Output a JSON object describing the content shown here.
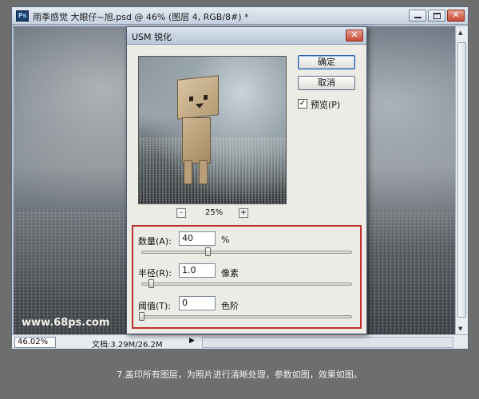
{
  "document": {
    "title": "雨季感觉  大眼仔~旭.psd @ 46% (图层 4, RGB/8#) *",
    "app_icon": "Ps",
    "zoom": "46.02%",
    "doc_size": "文档:3.29M/26.2M",
    "watermark": "www.68ps.com"
  },
  "dialog": {
    "title": "USM 锐化",
    "ok_label": "确定",
    "cancel_label": "取消",
    "preview_label": "预览(P)",
    "preview_checked": true,
    "preview_zoom": "25%",
    "zoom_out": "-",
    "zoom_in": "+",
    "amount": {
      "label": "数量(A):",
      "value": "40",
      "unit": "%"
    },
    "radius": {
      "label": "半径(R):",
      "value": "1.0",
      "unit": "像素"
    },
    "threshold": {
      "label": "阈值(T):",
      "value": "0",
      "unit": "色阶"
    }
  },
  "caption": "7.盖印所有图层，为照片进行清晰处理，参数如图，效果如图。",
  "colors": {
    "highlight_box": "#c0302a",
    "titlebar": "#c6d2e0"
  }
}
